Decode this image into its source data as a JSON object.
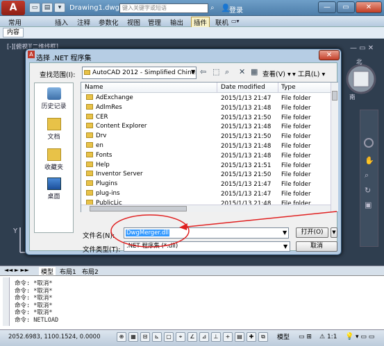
{
  "titlebar": {
    "doc_title": "Drawing1.dwg",
    "search_placeholder": "键入关键字或短语",
    "login": "登录",
    "logo": "A"
  },
  "menu": [
    "常用",
    "插入",
    "注释",
    "参数化",
    "视图",
    "管理",
    "输出",
    "插件",
    "联机"
  ],
  "menu_active_index": 7,
  "ribbon_tab": "内容",
  "viewport_label": "[-][俯视][二维线框]",
  "compass": {
    "north": "北",
    "south": "南"
  },
  "dialog": {
    "title": "选择 .NET 程序集",
    "look_in_label": "查找范围(I):",
    "look_in_value": "AutoCAD 2012 - Simplified Chinese",
    "view_label": "查看(V)",
    "tools_label": "工具(L)",
    "places": [
      "历史记录",
      "文档",
      "收藏夹",
      "桌面"
    ],
    "columns": {
      "name": "Name",
      "date": "Date modified",
      "type": "Type"
    },
    "files": [
      {
        "name": "AdExchange",
        "date": "2015/1/13 21:47",
        "type": "File folder"
      },
      {
        "name": "AdlmRes",
        "date": "2015/1/13 21:48",
        "type": "File folder"
      },
      {
        "name": "CER",
        "date": "2015/1/13 21:50",
        "type": "File folder"
      },
      {
        "name": "Content Explorer",
        "date": "2015/1/13 21:48",
        "type": "File folder"
      },
      {
        "name": "Drv",
        "date": "2015/1/13 21:50",
        "type": "File folder"
      },
      {
        "name": "en",
        "date": "2015/1/13 21:48",
        "type": "File folder"
      },
      {
        "name": "Fonts",
        "date": "2015/1/13 21:48",
        "type": "File folder"
      },
      {
        "name": "Help",
        "date": "2015/1/13 21:51",
        "type": "File folder"
      },
      {
        "name": "Inventor Server",
        "date": "2015/1/13 21:50",
        "type": "File folder"
      },
      {
        "name": "Plugins",
        "date": "2015/1/13 21:47",
        "type": "File folder"
      },
      {
        "name": "plug-ins",
        "date": "2015/1/13 21:47",
        "type": "File folder"
      },
      {
        "name": "PublicLic",
        "date": "2015/1/13 21:48",
        "type": "File folder"
      }
    ],
    "filename_label": "文件名(N):",
    "filename_value": "DwgMerger.dll",
    "filetype_label": "文件类型(T):",
    "filetype_value": ".NET 程序集 (*.dll)",
    "open_label": "打开(O)",
    "cancel_label": "取消"
  },
  "layout_tabs": [
    "模型",
    "布局1",
    "布局2"
  ],
  "command_lines": [
    "命令: *取消*",
    "命令: *取消*",
    "命令: *取消*",
    "命令: *取消*",
    "命令: *取消*",
    "命令: NETLOAD"
  ],
  "status": {
    "coords": "2052.6983, 1100.1524, 0.0000",
    "model": "模型",
    "scale": "1:1"
  },
  "colors": {
    "annotation_red": "#e02020",
    "selection": "#3399ff",
    "title_bar": "#5b8bb8"
  }
}
